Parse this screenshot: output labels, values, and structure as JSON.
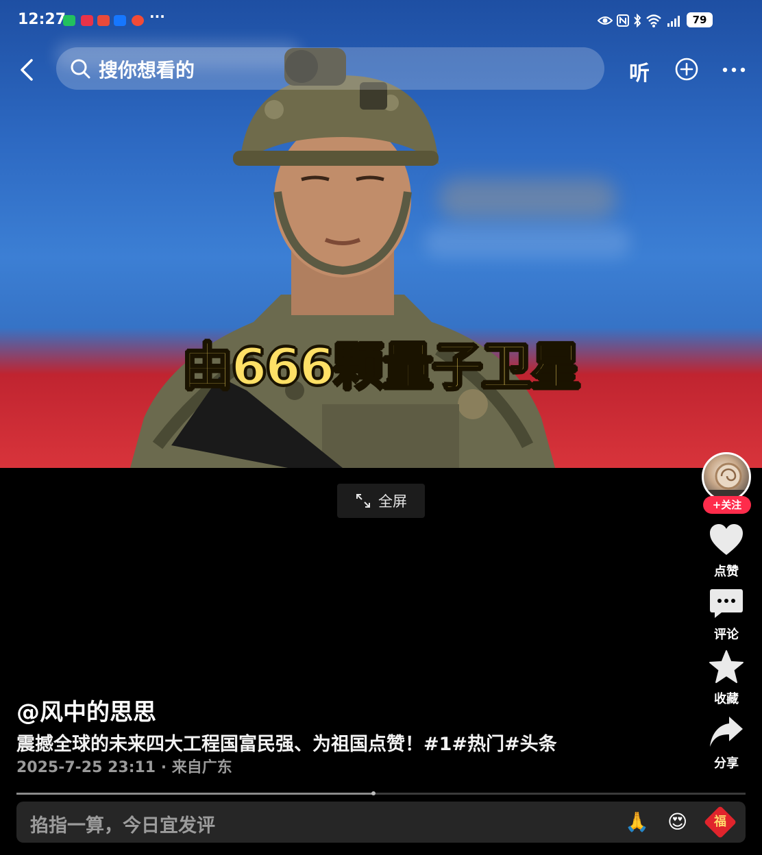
{
  "status_bar": {
    "time": "12:27",
    "more": "···",
    "battery": "79"
  },
  "nav": {
    "search_placeholder": "搜你想看的",
    "listen_label": "听"
  },
  "video": {
    "subtitle": "由666颗量子卫星",
    "fullscreen_label": "全屏"
  },
  "rail": {
    "follow_label": "+关注",
    "like_label": "点赞",
    "comment_label": "评论",
    "favorite_label": "收藏",
    "share_label": "分享"
  },
  "post": {
    "author": "@风中的思思",
    "description": "震撼全球的未来四大工程国富民强、为祖国点赞！#1#热门#头条",
    "meta": "2025-7-25 23:11 · 来自广东",
    "progress": 0.49
  },
  "comment_bar": {
    "placeholder": "掐指一算，今日宜发评",
    "emojis": [
      "🙏",
      "😍",
      "福"
    ]
  },
  "colors": {
    "accent_red": "#fe2c4b",
    "subtitle_yellow": "#ffe066"
  }
}
